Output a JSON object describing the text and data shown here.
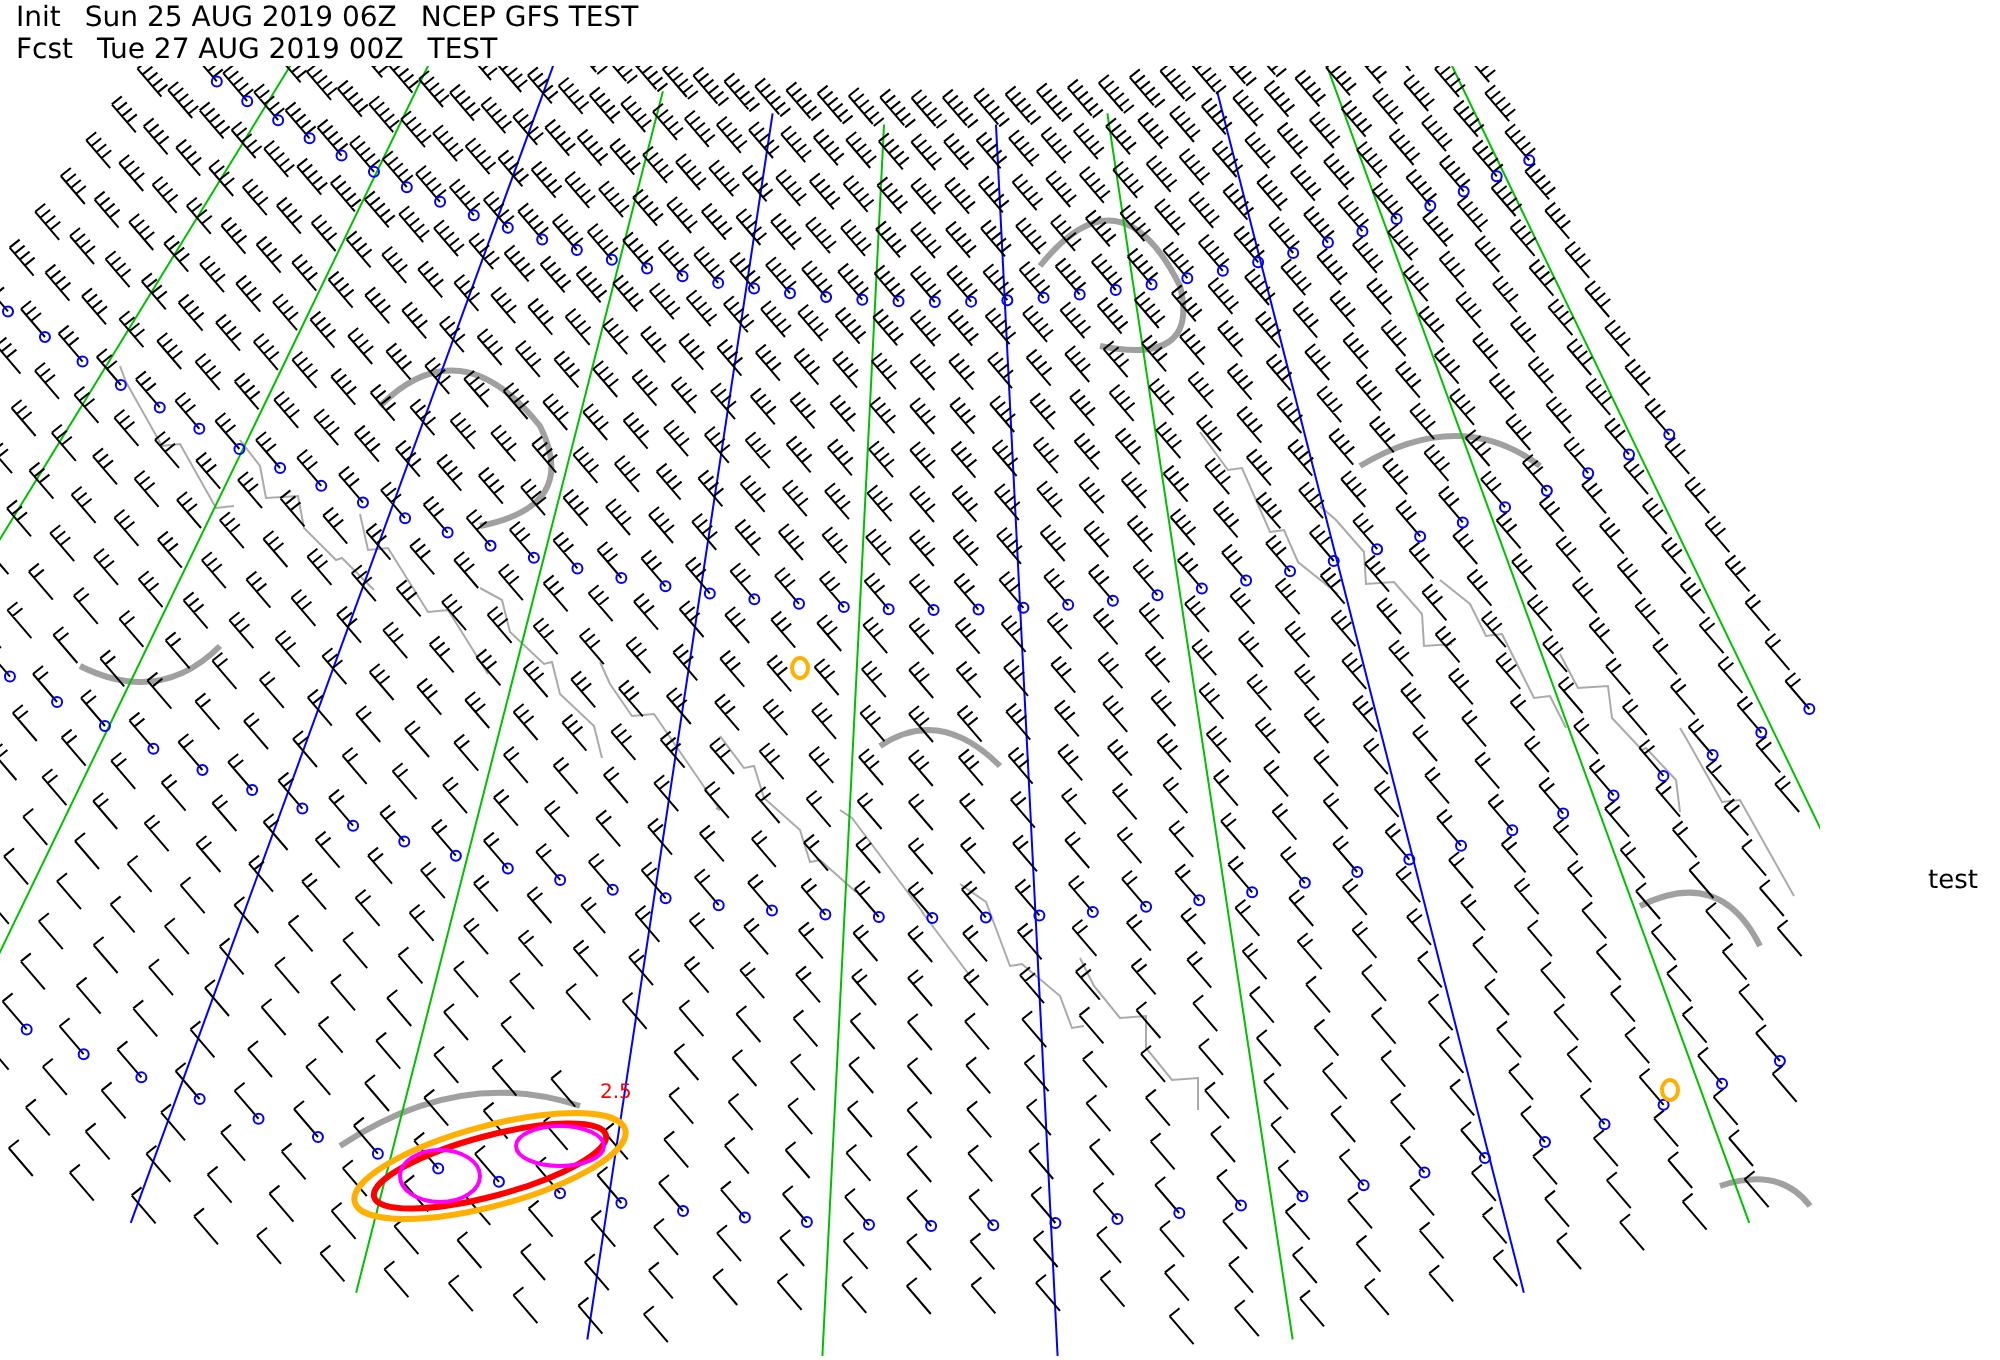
{
  "header": {
    "lines": [
      {
        "label": "Init",
        "date": "Sun 25 AUG 2019 06Z",
        "model": "NCEP GFS TEST"
      },
      {
        "label": "Fcst",
        "date": "Tue 27 AUG 2019 00Z",
        "model": "TEST"
      }
    ]
  },
  "map": {
    "contour_label": "2.5",
    "side_label": "test"
  }
}
